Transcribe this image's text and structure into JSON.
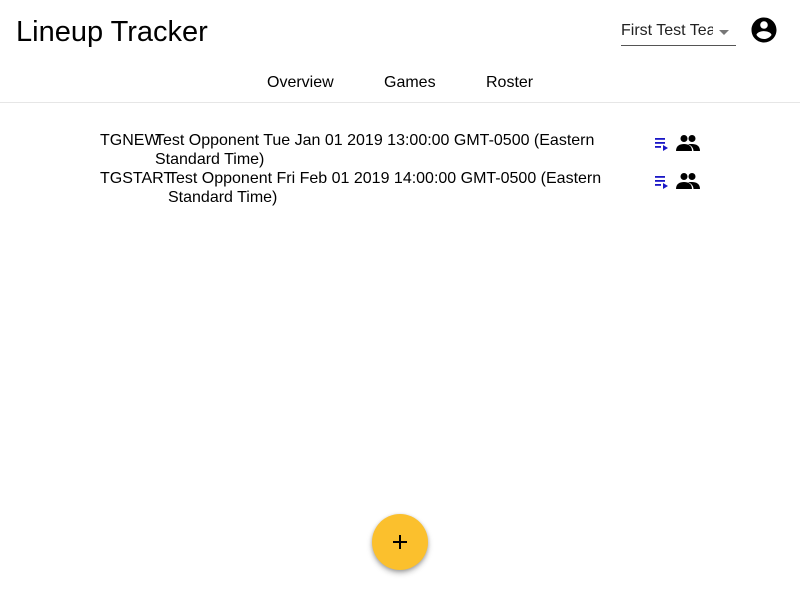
{
  "app": {
    "title": "Lineup Tracker"
  },
  "team_select": {
    "value": "First Test Team",
    "icon": "chevron-down-icon"
  },
  "account": {
    "icon": "account-circle-icon"
  },
  "tabs": [
    {
      "label": "Overview"
    },
    {
      "label": "Games"
    },
    {
      "label": "Roster"
    }
  ],
  "games": [
    {
      "id": "TGNEW",
      "description": "Test Opponent Tue Jan 01 2019 13:00:00 GMT-0500 (Eastern Standard Time)"
    },
    {
      "id": "TGSTART",
      "description": "Test Opponent Fri Feb 01 2019 14:00:00 GMT-0500 (Eastern Standard Time)"
    }
  ],
  "row_actions": {
    "lineup_icon": "playlist-play-icon",
    "roster_icon": "people-icon"
  },
  "fab": {
    "icon": "add-icon"
  },
  "colors": {
    "fab": "#fbc02d",
    "lineup_icon": "#1a17c6",
    "text": "#000000"
  }
}
